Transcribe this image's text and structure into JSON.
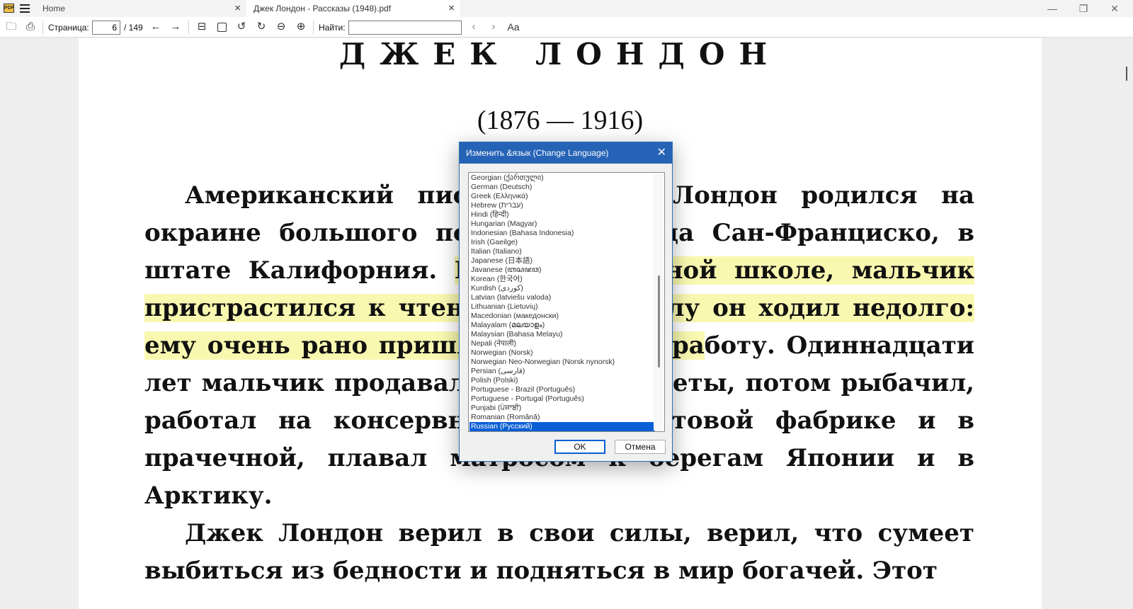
{
  "tabs": [
    {
      "label": "Home"
    },
    {
      "label": "Джек Лондон - Рассказы (1948).pdf"
    }
  ],
  "icons": {
    "app_logo": "app-logo-icon",
    "menu": "hamburger-menu-icon",
    "tab_close": "close-icon",
    "minimize": "minimize-icon",
    "restore": "restore-icon",
    "close": "close-icon"
  },
  "app_logo_text": "PDF",
  "toolbar": {
    "page_label": "Страница:",
    "page_value": "6",
    "page_total": "/ 149",
    "find_label": "Найти:",
    "find_value": "",
    "font_label": "Aa"
  },
  "document": {
    "heading": "ДЖЕК ЛОНДОН",
    "years": "(1876 — 1916)",
    "para1_a": "Американский писатель Джек Лондон родился на окраине большого портового города Сан-Франциско, в штате Калифорния. ",
    "para1_hl": "Ещё в начальной школе, мальчик пристрастился к чтению. Но в школу он ходил недолго: ему очень рано пришлось пойти на ра",
    "para1_b": "боту. Одиннадцати лет мальчик продавал на улицах газеты, потом рыбачил, работал на консервной и на джутовой фабрике и в прачечной, плавал матросом к берегам Японии и в Арктику.",
    "para2": "Джек Лондон верил в свои силы, верил, что сумеет выбиться из бедности и подняться в мир богачей. Этот"
  },
  "dialog": {
    "title": "Изменить &язык (Change Language)",
    "ok": "OK",
    "cancel": "Отмена",
    "languages": [
      "Georgian (ქართული)",
      "German (Deutsch)",
      "Greek (Ελληνικά)",
      "Hebrew (עברית)",
      "Hindi (हिन्दी)",
      "Hungarian (Magyar)",
      "Indonesian (Bahasa Indonesia)",
      "Irish (Gaeilge)",
      "Italian (Italiano)",
      "Japanese (日本語)",
      "Javanese (ꦧꦱꦗꦮ)",
      "Korean (한국어)",
      "Kurdish (کوردی)",
      "Latvian (latviešu valoda)",
      "Lithuanian (Lietuvių)",
      "Macedonian (македонски)",
      "Malayalam (മലയാളം)",
      "Malaysian (Bahasa Melayu)",
      "Nepali (नेपाली)",
      "Norwegian (Norsk)",
      "Norwegian Neo-Norwegian (Norsk nynorsk)",
      "Persian (فارسی)",
      "Polish (Polski)",
      "Portuguese - Brazil (Português)",
      "Portuguese - Portugal (Português)",
      "Punjabi (ਪੰਜਾਬੀ)",
      "Romanian (Română)",
      "Russian (Русский)"
    ],
    "selected": "Russian (Русский)"
  },
  "colors": {
    "dialog_title_bg": "#2563b6",
    "selection": "#0a5fd6",
    "highlight": "#f9f8b0"
  }
}
